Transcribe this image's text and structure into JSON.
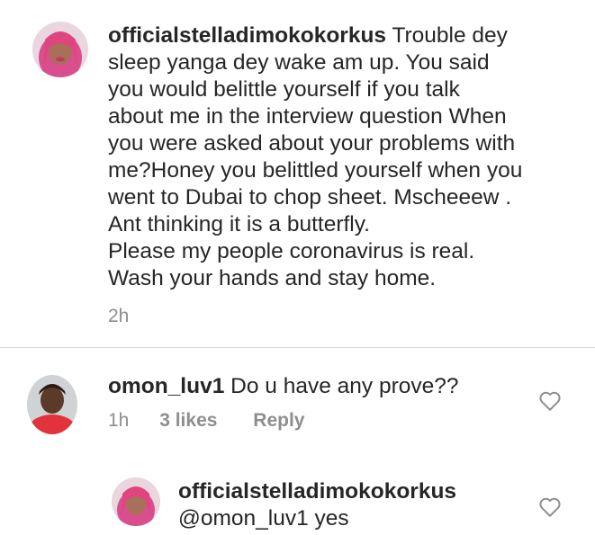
{
  "post_caption": {
    "username": "officialstelladimokokorkus",
    "lines": [
      "Trouble dey",
      "sleep yanga dey wake am up. You said",
      "you would belittle yourself if you talk",
      "about me in the interview question When",
      "you were asked about your problems with",
      "me?Honey you belittled yourself when you",
      "went to Dubai to chop sheet. Mscheeew .",
      "Ant thinking it is a butterfly.",
      "Please my people coronavirus is real.",
      "Wash your hands and stay home."
    ],
    "time": "2h"
  },
  "comment": {
    "username": "omon_luv1",
    "text": "Do u have any prove??",
    "time": "1h",
    "likes": "3 likes",
    "reply_label": "Reply",
    "like_icon": "heart-outline-icon"
  },
  "reply": {
    "username": "officialstelladimokokorkus",
    "text": "@omon_luv1 yes",
    "like_icon": "heart-outline-icon"
  },
  "colors": {
    "text": "#262626",
    "secondary": "#8e8e8e",
    "divider": "#dbdbdb"
  }
}
